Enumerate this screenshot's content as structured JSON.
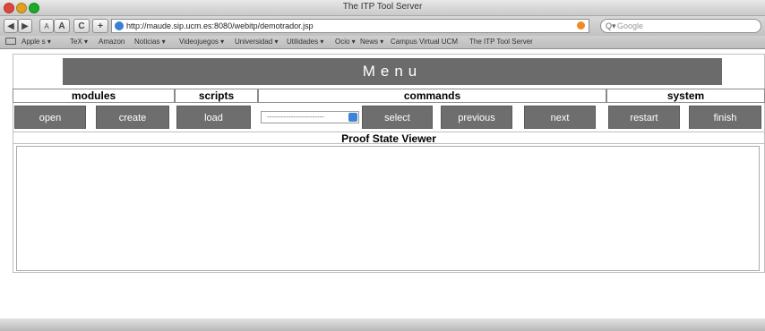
{
  "window": {
    "title": "The ITP Tool Server"
  },
  "toolbar": {
    "back": "◀",
    "forward": "▶",
    "text_small": "A",
    "text_large": "A",
    "reload": "C",
    "add": "+",
    "url": "http://maude.sip.ucm.es:8080/webitp/demotrador.jsp",
    "search_placeholder": "Google"
  },
  "bookmarks": [
    {
      "label": "Apple  s ▾"
    },
    {
      "label": "TeX ▾"
    },
    {
      "label": "Amazon"
    },
    {
      "label": "Noticias ▾"
    },
    {
      "label": "Videojuegos ▾"
    },
    {
      "label": "Universidad ▾"
    },
    {
      "label": "Utilidades ▾"
    },
    {
      "label": "Ocio ▾"
    },
    {
      "label": "News ▾"
    },
    {
      "label": "Campus Virtual UCM"
    },
    {
      "label": "The ITP Tool Server"
    }
  ],
  "page": {
    "menu_title": "Menu",
    "sections": {
      "modules": "modules",
      "scripts": "scripts",
      "commands": "commands",
      "system": "system"
    },
    "buttons": {
      "open": "open",
      "create": "create",
      "load": "load",
      "select": "select",
      "previous": "previous",
      "next": "next",
      "restart": "restart",
      "finish": "finish"
    },
    "select_value": "------------------------",
    "proof_state_title": "Proof State Viewer"
  },
  "colors": {
    "menu_bg": "#6b6b6b",
    "button_bg": "#6e6e6e"
  }
}
